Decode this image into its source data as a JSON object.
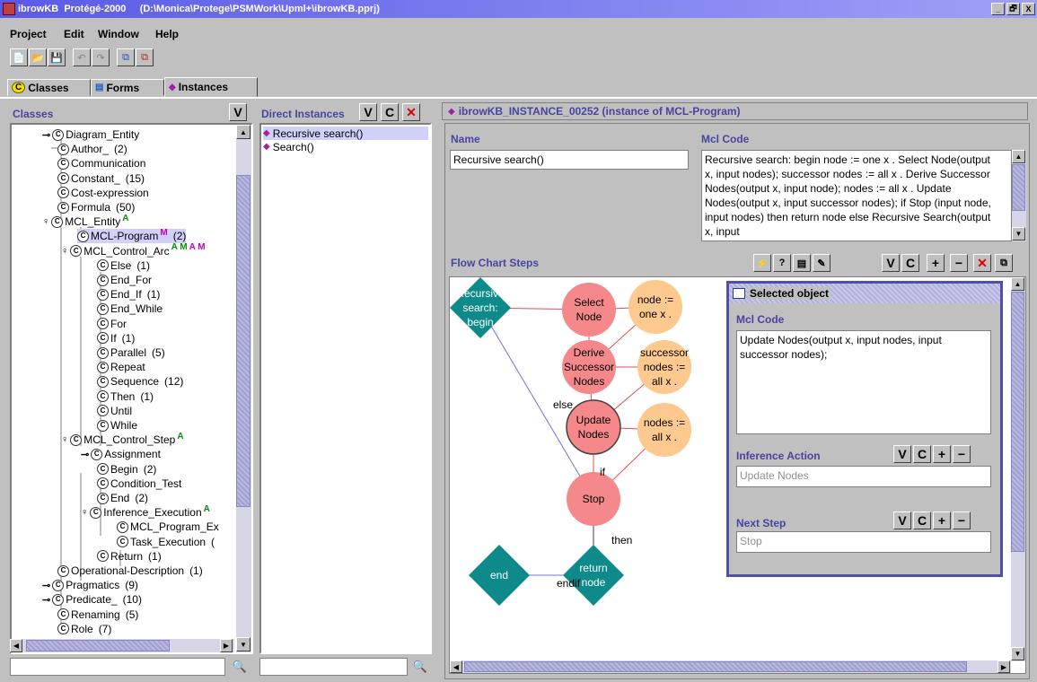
{
  "window": {
    "title": "ibrowKB  Protégé-2000     (D:\\Monica\\Protege\\PSMWork\\Upml+\\ibrowKB.pprj)",
    "min_glyph": "_",
    "max_glyph": "🗗",
    "close_glyph": "X"
  },
  "menu": {
    "items": [
      "Project",
      "Edit",
      "Window",
      "Help"
    ]
  },
  "toolbar": {
    "new_icon": "📄",
    "open_icon": "📂",
    "save_icon": "💾",
    "undo_icon": "↶",
    "redo_icon": "↷",
    "b1_icon": "⧉",
    "b2_icon": "⧉"
  },
  "tabs": [
    {
      "label": "Classes",
      "icon": "C"
    },
    {
      "label": "Forms",
      "icon": "▤"
    },
    {
      "label": "Instances",
      "icon": "◆"
    }
  ],
  "classes_panel": {
    "title": "Classes",
    "v_button": "V",
    "tree": [
      {
        "label": "Diagram_Entity",
        "count": "",
        "badges": ""
      },
      {
        "label": "Author_",
        "count": "(2)",
        "badges": ""
      },
      {
        "label": "Communication",
        "count": "",
        "badges": ""
      },
      {
        "label": "Constant_",
        "count": "(15)",
        "badges": ""
      },
      {
        "label": "Cost-expression",
        "count": "",
        "badges": ""
      },
      {
        "label": "Formula",
        "count": "(50)",
        "badges": ""
      },
      {
        "label": "MCL_Entity",
        "count": "",
        "badges": "A"
      },
      {
        "label": "MCL-Program",
        "count": "(2)",
        "badges": "M"
      },
      {
        "label": "MCL_Control_Arc",
        "count": "",
        "badges": "A M"
      },
      {
        "label": "Else",
        "count": "(1)",
        "badges": ""
      },
      {
        "label": "End_For",
        "count": "",
        "badges": ""
      },
      {
        "label": "End_If",
        "count": "(1)",
        "badges": ""
      },
      {
        "label": "End_While",
        "count": "",
        "badges": ""
      },
      {
        "label": "For",
        "count": "",
        "badges": ""
      },
      {
        "label": "If",
        "count": "(1)",
        "badges": ""
      },
      {
        "label": "Parallel",
        "count": "(5)",
        "badges": ""
      },
      {
        "label": "Repeat",
        "count": "",
        "badges": ""
      },
      {
        "label": "Sequence",
        "count": "(12)",
        "badges": ""
      },
      {
        "label": "Then",
        "count": "(1)",
        "badges": ""
      },
      {
        "label": "Until",
        "count": "",
        "badges": ""
      },
      {
        "label": "While",
        "count": "",
        "badges": ""
      },
      {
        "label": "MCL_Control_Step",
        "count": "",
        "badges": "A"
      },
      {
        "label": "Assignment",
        "count": "",
        "badges": ""
      },
      {
        "label": "Begin",
        "count": "(2)",
        "badges": ""
      },
      {
        "label": "Condition_Test",
        "count": "",
        "badges": ""
      },
      {
        "label": "End",
        "count": "(2)",
        "badges": ""
      },
      {
        "label": "Inference_Execution",
        "count": "",
        "badges": "A"
      },
      {
        "label": "MCL_Program_Ex",
        "count": "",
        "badges": ""
      },
      {
        "label": "Task_Execution",
        "count": "(",
        "badges": ""
      },
      {
        "label": "Return",
        "count": "(1)",
        "badges": ""
      },
      {
        "label": "Operational-Description",
        "count": "(1)",
        "badges": ""
      },
      {
        "label": "Pragmatics",
        "count": "(9)",
        "badges": ""
      },
      {
        "label": "Predicate_",
        "count": "(10)",
        "badges": ""
      },
      {
        "label": "Renaming",
        "count": "(5)",
        "badges": ""
      },
      {
        "label": "Role",
        "count": "(7)",
        "badges": ""
      }
    ],
    "search_icon": "🔍"
  },
  "instances_panel": {
    "title": "Direct Instances",
    "v_button": "V",
    "c_button": "C",
    "x_button": "✕",
    "items": [
      "Recursive search()",
      "Search()"
    ],
    "search_icon": "🔍"
  },
  "form_panel": {
    "header": "ibrowKB_INSTANCE_00252  (instance of MCL-Program)",
    "name_label": "Name",
    "name_value": "Recursive search()",
    "mcl_code_label": "Mcl Code",
    "mcl_code_value": "Recursive search: begin node := one x . Select Node(output x, input nodes); successor nodes := all x . Derive Successor Nodes(output x, input node); nodes := all x . Update Nodes(output x, input successor nodes); if Stop (input node, input nodes) then return node else Recursive Search(output x, input",
    "flow_label": "Flow Chart Steps",
    "flow_buttons": [
      "⚡",
      "?",
      "▤",
      "✎",
      "V",
      "C",
      "+",
      "−",
      "✕",
      "⧉"
    ]
  },
  "flow_chart": {
    "nodes": [
      {
        "id": "recursive",
        "shape": "diamond",
        "lines": [
          "Recursive",
          "search:",
          "begin"
        ]
      },
      {
        "id": "select",
        "shape": "circle-red",
        "lines": [
          "Select",
          "Node"
        ]
      },
      {
        "id": "nodeone",
        "shape": "circle-orange",
        "lines": [
          "node :=",
          "one x ."
        ]
      },
      {
        "id": "derive",
        "shape": "circle-red",
        "lines": [
          "Derive",
          "Successor",
          "Nodes"
        ]
      },
      {
        "id": "succnodes",
        "shape": "circle-orange",
        "lines": [
          "successor",
          "nodes :=",
          "all x ."
        ]
      },
      {
        "id": "update",
        "shape": "circle-red",
        "lines": [
          "Update",
          "Nodes"
        ]
      },
      {
        "id": "nodesall",
        "shape": "circle-orange",
        "lines": [
          "nodes :=",
          "all x ."
        ]
      },
      {
        "id": "stop",
        "shape": "circle-red",
        "lines": [
          "Stop"
        ]
      },
      {
        "id": "end",
        "shape": "diamond",
        "lines": [
          "end"
        ]
      },
      {
        "id": "return",
        "shape": "diamond",
        "lines": [
          "return",
          "node"
        ]
      }
    ],
    "edge_labels": [
      "else",
      "if",
      "then",
      "endif"
    ]
  },
  "selected_object": {
    "title": "Selected object",
    "mcl_code_label": "Mcl Code",
    "mcl_code_value": "Update Nodes(output x, input nodes, input successor nodes);",
    "inference_label": "Inference Action",
    "inference_value": "Update Nodes",
    "next_label": "Next Step",
    "next_value": "Stop",
    "btn_v": "V",
    "btn_c": "C",
    "btn_plus": "+",
    "btn_minus": "−"
  },
  "colors": {
    "red_node": "#f4888a",
    "orange_node": "#fdc98f",
    "diamond": "#0e8a8a",
    "accent": "#4646a0"
  }
}
